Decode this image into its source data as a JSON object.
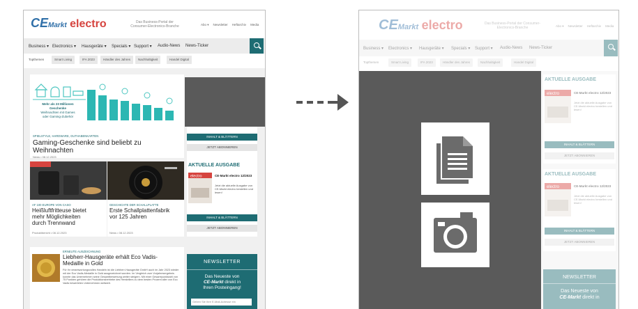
{
  "site": {
    "logo_ce": "CE",
    "logo_markt": "Markt",
    "logo_electro": "electro",
    "tagline": "Das Business-Portal der Consumer-Electronics-Branche",
    "top_links": [
      "Abo ▾",
      "Newsletter",
      "Heftarchiv",
      "Media"
    ]
  },
  "nav": {
    "items": [
      "Business ▾",
      "Electronics ▾",
      "Hausgeräte ▾",
      "Specials ▾",
      "Support ▾",
      "Audio-News",
      "News-Ticker"
    ]
  },
  "topics": {
    "label": "Topthemen",
    "items": [
      "Smart Living",
      "IFA 2023",
      "Händler des Jahres",
      "Nachhaltigkeit",
      "Handel Digital"
    ]
  },
  "hero": {
    "kicker": "SPIELSTYLE, HARDWARE, GUTHABENKARTEN",
    "title_line1": "Gaming-Geschenke sind beliebt zu",
    "title_line2": "Weihnachten",
    "meta": "News • 08.12.2023"
  },
  "article2": {
    "kicker": "AF 100 EUROPE VON CASO",
    "title_line1": "Heißluftfritteuse bietet",
    "title_line2": "mehr Möglichkeiten",
    "title_line3": "durch Trennwand",
    "meta": "Produktbericht • 08.12.2023"
  },
  "article3": {
    "kicker": "GESCHICHTE DER SCHALLPLATTE",
    "title_line1": "Erste Schallplattenfabrik",
    "title_line2": "vor 125 Jahren",
    "meta": "News • 08.12.2023"
  },
  "sidebar": {
    "btn_inhalt": "INHALT & BLÄTTERN",
    "btn_abo": "JETZT ABONNIEREN",
    "aktuelle_ausgabe": "AKTUELLE AUSGABE",
    "issue_title": "CE-Markt electro 12/2023",
    "issue_text": "Jetzt die aktuelle Ausgabe von CE-Markt electro bestellen und lesen!",
    "mag_label": "electro"
  },
  "article4": {
    "kicker": "ERNEUTE AUSZEICHNUNG",
    "title_line1": "Liebherr-Hausgeräte erhält Eco Vadis-",
    "title_line2": "Medaille in Gold",
    "body": "Für ihr verantwortungsvolles Handeln ist die Liebherr-Hausgeräte GmbH auch im Jahr 2023 wieder mit der Eco Vadis-Medaille in Gold ausgezeichnet worden. Im Vergleich zum Vorjahresergebnis konnte das Unternehmen seine Gesamtbewertung weiter steigern. Mit einer Gesamtpunktzahl von 75 Punkten gehören die Produktionsbetriebe des Herstellers zu dem besten Prozent aller von Eco Vadis bewerteten Unternehmen weltweit."
  },
  "newsletter": {
    "title": "NEWSLETTER",
    "text1": "Das Neueste von",
    "brand": "CE-Markt",
    "text2": "direkt in",
    "text3": "Ihren Posteingang!",
    "placeholder": "Geben Sie Ihre E-Mail-Adresse ein"
  },
  "infographic": {
    "headline": "Mehr als 23 Millionen Geschenke möchten zu Weihnachten mit Games oder Gaming-Zubehör"
  },
  "colors": {
    "brand_blue": "#2f6fa8",
    "brand_red": "#d6443f",
    "teal": "#1e6c73",
    "overlay_grey": "#5a5a5a"
  },
  "icons": [
    "document-copy-icon",
    "camera-icon",
    "search-icon",
    "arrow-right-icon"
  ]
}
